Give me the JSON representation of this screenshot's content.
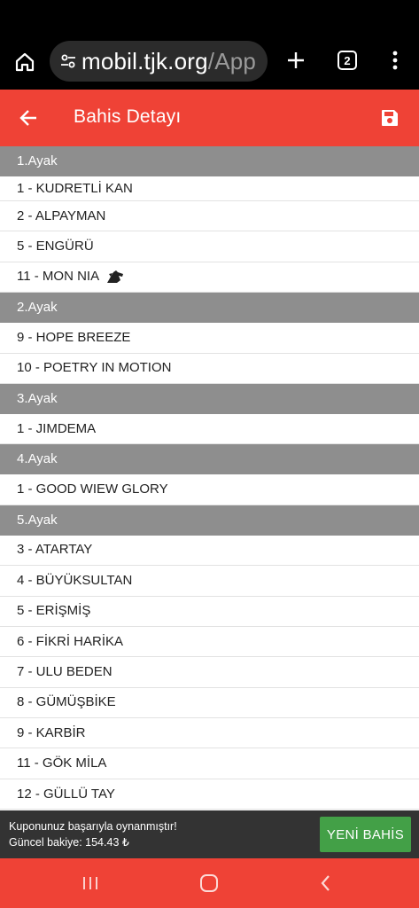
{
  "browser": {
    "url_host": "mobil.tjk.org",
    "url_path": "/App",
    "tab_count": "2"
  },
  "header": {
    "title": "Bahis Detayı"
  },
  "legs": [
    {
      "label": "1.Ayak",
      "horses": [
        "1 - KUDRETLİ KAN",
        "2 - ALPAYMAN",
        "5 - ENGÜRÜ",
        "11 - MON NIA"
      ]
    },
    {
      "label": "2.Ayak",
      "horses": [
        "9 - HOPE BREEZE",
        "10 - POETRY IN MOTION"
      ]
    },
    {
      "label": "3.Ayak",
      "horses": [
        "1 - JIMDEMA"
      ]
    },
    {
      "label": "4.Ayak",
      "horses": [
        "1 - GOOD WIEW GLORY"
      ]
    },
    {
      "label": "5.Ayak",
      "horses": [
        "3 - ATARTAY",
        "4 - BÜYÜKSULTAN",
        "5 - ERİŞMİŞ",
        "6 - FİKRİ HARİKA",
        "7 - ULU BEDEN",
        "8 - GÜMÜŞBİKE",
        "9 - KARBİR",
        "11 - GÖK MİLA",
        "12 - GÜLLÜ TAY"
      ]
    }
  ],
  "snackbar": {
    "message": "Kuponunuz başarıyla oynanmıştır!",
    "balance": "Güncel bakiye: 154.43 ₺",
    "button_label": "YENİ BAHİS"
  },
  "icons": {
    "home": "home-icon",
    "site_settings": "site-settings-icon",
    "new_tab": "plus-icon",
    "tabs": "tab-switcher-icon",
    "menu": "kebab-menu-icon",
    "back": "arrow-left-icon",
    "save": "floppy-disk-icon",
    "horse_badge": "horse-head-icon"
  },
  "colors": {
    "brand_red": "#ef4236",
    "leg_header_gray": "#8e8e8e",
    "success_green": "#43a047",
    "snackbar_bg": "#333333"
  }
}
